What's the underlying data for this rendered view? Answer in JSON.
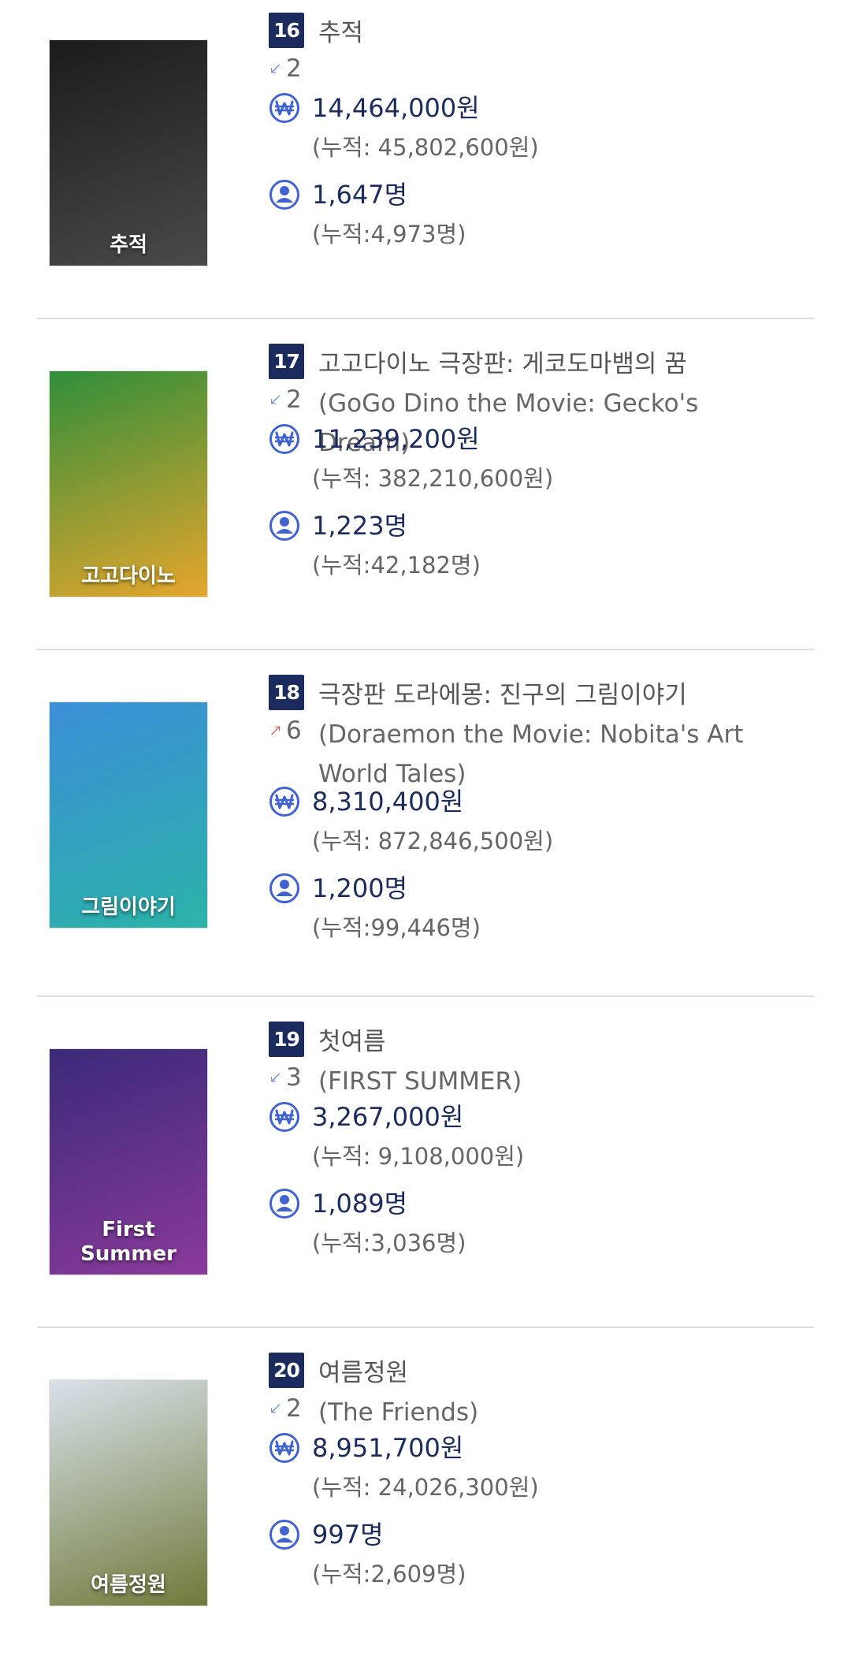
{
  "colors": {
    "badge": "#1c2b5e",
    "primary_text": "#1c2b5e",
    "icon": "#3f63d0",
    "down_arrow": "#5b7fd6",
    "up_arrow": "#e05050",
    "divider": "#dcdcdc"
  },
  "entries": [
    {
      "rank": "16",
      "title_ko": "추적",
      "change_dir": "down",
      "change": "2",
      "title_en": "",
      "revenue": "14,464,000원",
      "revenue_total": "(누적: 45,802,600원)",
      "audience": "1,647명",
      "audience_total": "(누적:4,973명)",
      "poster_colors": [
        "#1b1b1b",
        "#4a4a4a"
      ],
      "poster_text": "추적"
    },
    {
      "rank": "17",
      "title_ko": "고고다이노 극장판: 게코도마뱀의 꿈",
      "change_dir": "down",
      "change": "2",
      "title_en": "(GoGo Dino the Movie: Gecko's Dream)",
      "revenue": "11,239,200원",
      "revenue_total": "(누적: 382,210,600원)",
      "audience": "1,223명",
      "audience_total": "(누적:42,182명)",
      "poster_colors": [
        "#2f8f3a",
        "#e6a62c"
      ],
      "poster_text": "고고다이노"
    },
    {
      "rank": "18",
      "title_ko": "극장판 도라에몽: 진구의 그림이야기",
      "change_dir": "up",
      "change": "6",
      "title_en": "(Doraemon the Movie: Nobita's Art World Tales)",
      "revenue": "8,310,400원",
      "revenue_total": "(누적: 872,846,500원)",
      "audience": "1,200명",
      "audience_total": "(누적:99,446명)",
      "poster_colors": [
        "#3b8fd8",
        "#2bb3a8"
      ],
      "poster_text": "그림이야기"
    },
    {
      "rank": "19",
      "title_ko": "첫여름",
      "change_dir": "down",
      "change": "3",
      "title_en": "(FIRST SUMMER)",
      "revenue": "3,267,000원",
      "revenue_total": "(누적: 9,108,000원)",
      "audience": "1,089명",
      "audience_total": "(누적:3,036명)",
      "poster_colors": [
        "#3a2a7a",
        "#8a3a9a"
      ],
      "poster_text": "First Summer"
    },
    {
      "rank": "20",
      "title_ko": "여름정원",
      "change_dir": "down",
      "change": "2",
      "title_en": "(The Friends)",
      "revenue": "8,951,700원",
      "revenue_total": "(누적: 24,026,300원)",
      "audience": "997명",
      "audience_total": "(누적:2,609명)",
      "poster_colors": [
        "#d8e2ea",
        "#6f7a3a"
      ],
      "poster_text": "여름정원"
    }
  ]
}
